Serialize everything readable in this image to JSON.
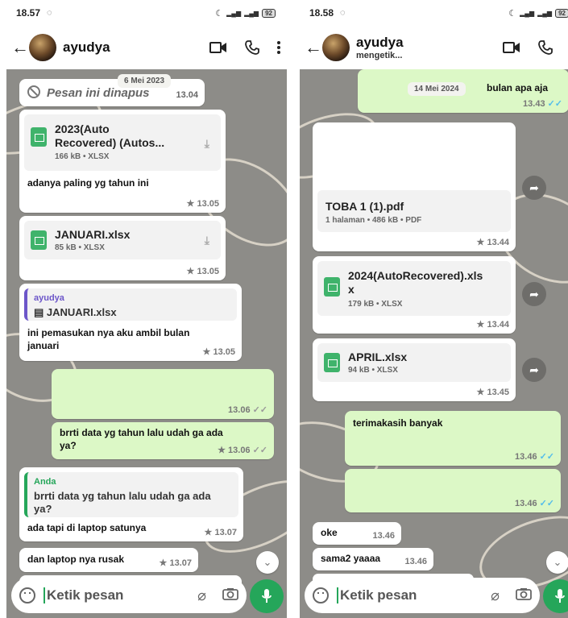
{
  "left": {
    "status": {
      "time": "18.57",
      "battery": "92"
    },
    "contact": {
      "name": "ayudya"
    },
    "date_chip": "6 Mei 2023",
    "messages": {
      "deleted": {
        "text": "Pesan ini dinapus",
        "time": "13.04"
      },
      "file1": {
        "name_line1": "2023(Auto",
        "name_line2": "Recovered) (Autos...",
        "info": "166 kB • XLSX",
        "caption": "adanya paling yg tahun ini",
        "time": "★ 13.05"
      },
      "file2": {
        "name": "JANUARI.xlsx",
        "info": "85 kB • XLSX",
        "time": "★ 13.05"
      },
      "reply1": {
        "quote_name": "ayudya",
        "quote_file": "JANUARI.xlsx",
        "text_line1": "ini pemasukan nya aku ambil bulan",
        "text_line2": "januari",
        "time": "★ 13.05"
      },
      "out_blank": {
        "time": "13.06"
      },
      "out_text": {
        "line1": "brrti data yg tahun lalu udah ga ada",
        "line2": "ya?",
        "time": "★ 13.06"
      },
      "reply2": {
        "quote_name": "Anda",
        "quote_line1": "brrti data yg tahun lalu udah ga ada",
        "quote_line2": "ya?",
        "text": "ada tapi di laptop satunya",
        "time": "★ 13.07"
      },
      "last": {
        "text": "dan laptop nya rusak",
        "time": "★ 13.07"
      }
    },
    "input_placeholder": "Ketik pesan"
  },
  "right": {
    "status": {
      "time": "18.58",
      "battery": "92"
    },
    "contact": {
      "name": "ayudya",
      "status": "mengetik..."
    },
    "date_chip": "14 Mei 2024",
    "messages": {
      "out_top": {
        "text": "bulan apa aja",
        "time": "13.43"
      },
      "pdf": {
        "name": "TOBA 1 (1).pdf",
        "info": "1 halaman • 486 kB • PDF",
        "time": "★ 13.44"
      },
      "file1": {
        "name_line1": "2024(AutoRecovered).xls",
        "name_line2": "x",
        "info": "179 kB • XLSX",
        "time": "★ 13.44"
      },
      "file2": {
        "name": "APRIL.xlsx",
        "info": "94 kB • XLSX",
        "time": "★ 13.45"
      },
      "out_thanks": {
        "text": "terimakasih banyak",
        "time": "13.46"
      },
      "out_blank": {
        "time": "13.46"
      },
      "oke": {
        "text": "oke",
        "time": "13.46"
      },
      "sama": {
        "text": "sama2 yaaaa",
        "time": "13.46"
      }
    },
    "input_placeholder": "Ketik pesan"
  },
  "icons": [
    "back-arrow-icon",
    "video-call-icon",
    "phone-icon",
    "more-vert-icon",
    "emoji-icon",
    "attach-icon",
    "camera-icon",
    "mic-icon",
    "forward-icon",
    "scroll-down-icon",
    "download-icon",
    "sheet-file-icon",
    "deleted-icon"
  ],
  "colors": {
    "accent": "#25a65a",
    "outgoing": "#dcf8c6",
    "read_tick": "#53bdeb",
    "chat_bg": "#8d8c88"
  }
}
